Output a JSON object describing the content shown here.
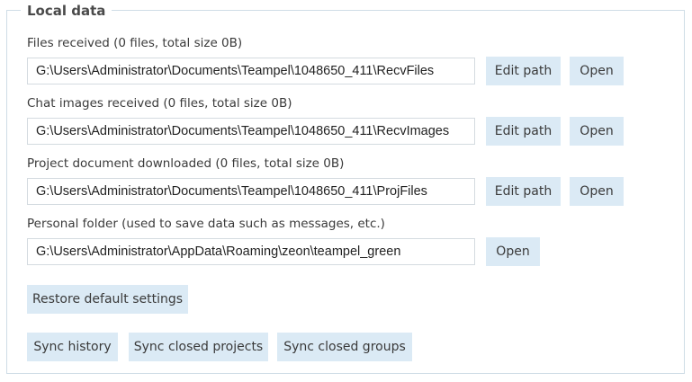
{
  "group_title": "Local data",
  "rows": [
    {
      "label": "Files received (0 files, total size 0B)",
      "path": "G:\\Users\\Administrator\\Documents\\Teampel\\1048650_411\\RecvFiles",
      "edit_label": "Edit path",
      "open_label": "Open"
    },
    {
      "label": "Chat images received (0 files, total size 0B)",
      "path": "G:\\Users\\Administrator\\Documents\\Teampel\\1048650_411\\RecvImages",
      "edit_label": "Edit path",
      "open_label": "Open"
    },
    {
      "label": "Project document downloaded (0 files, total size 0B)",
      "path": "G:\\Users\\Administrator\\Documents\\Teampel\\1048650_411\\ProjFiles",
      "edit_label": "Edit path",
      "open_label": "Open"
    },
    {
      "label": "Personal folder (used to save data such as messages, etc.)",
      "path": "G:\\Users\\Administrator\\AppData\\Roaming\\zeon\\teampel_green",
      "open_label": "Open"
    }
  ],
  "restore_label": "Restore default settings",
  "sync": {
    "history_label": "Sync history",
    "closed_projects_label": "Sync closed projects",
    "closed_groups_label": "Sync closed groups"
  }
}
